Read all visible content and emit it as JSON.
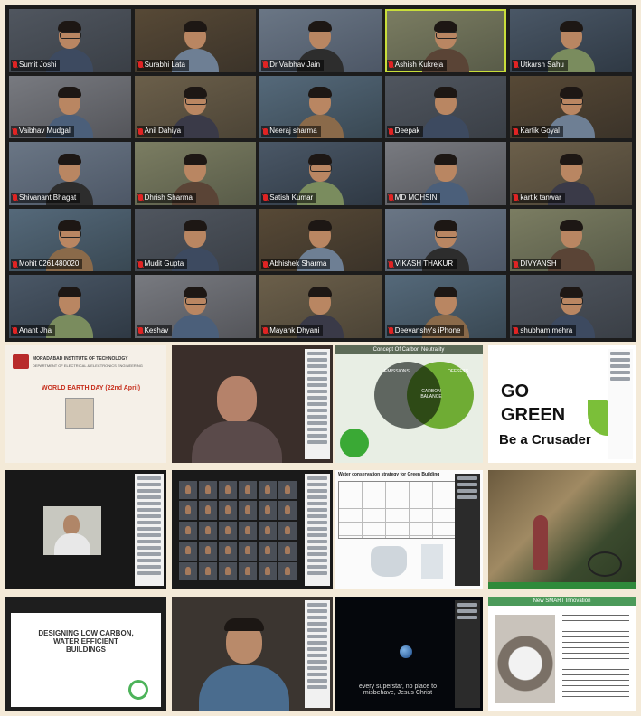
{
  "gallery": {
    "participants": [
      {
        "name": "Sumit Joshi"
      },
      {
        "name": "Surabhi Lata"
      },
      {
        "name": "Dr Vaibhav Jain"
      },
      {
        "name": "Ashish Kukreja"
      },
      {
        "name": "Utkarsh Sahu"
      },
      {
        "name": "Vaibhav Mudgal"
      },
      {
        "name": "Anil Dahiya"
      },
      {
        "name": "Neeraj sharma"
      },
      {
        "name": "Deepak"
      },
      {
        "name": "Kartik Goyal"
      },
      {
        "name": "Shivanant Bhagat"
      },
      {
        "name": "Dhrish Sharma"
      },
      {
        "name": "Satish Kumar"
      },
      {
        "name": "MD MOHSIN"
      },
      {
        "name": "kartik tanwar"
      },
      {
        "name": "Mohit 0261480020"
      },
      {
        "name": "Mudit Gupta"
      },
      {
        "name": "Abhishek Sharma"
      },
      {
        "name": "VIKASH THAKUR"
      },
      {
        "name": "DIVYANSH"
      },
      {
        "name": "Anant Jha"
      },
      {
        "name": "Keshav"
      },
      {
        "name": "Mayank Dhyani"
      },
      {
        "name": "Deevanshy's iPhone"
      },
      {
        "name": "shubham mehra"
      }
    ]
  },
  "collage": {
    "poster": {
      "org": "MORADABAD INSTITUTE OF TECHNOLOGY",
      "dept": "DEPARTMENT OF ELECTRICAL & ELECTRONICS ENGINEERING",
      "event": "WORLD EARTH DAY (22nd April)"
    },
    "carbon_slide": {
      "title": "Concept Of Carbon Neutrality",
      "circle_left": "EMISSIONS",
      "circle_right": "OFFSETS",
      "center": "CARBON BALANCE"
    },
    "go_green": {
      "line1": "GO",
      "line2": "GREEN",
      "line3": "Be a Crusader"
    },
    "water_table": {
      "title": "Water conservation strategy for Green Building"
    },
    "buildings_slide": {
      "title": "DESIGNING LOW CARBON, WATER EFFICIENT BUILDINGS"
    },
    "earth_slide": {
      "caption": "every superstar, no place to misbehave, Jesus Christ"
    },
    "shower_slide": {
      "title": "New SMART Innovation"
    }
  },
  "colors": {
    "active_speaker": "#c9de3a",
    "green_accent": "#3aa935",
    "mute_red": "#e02424"
  }
}
